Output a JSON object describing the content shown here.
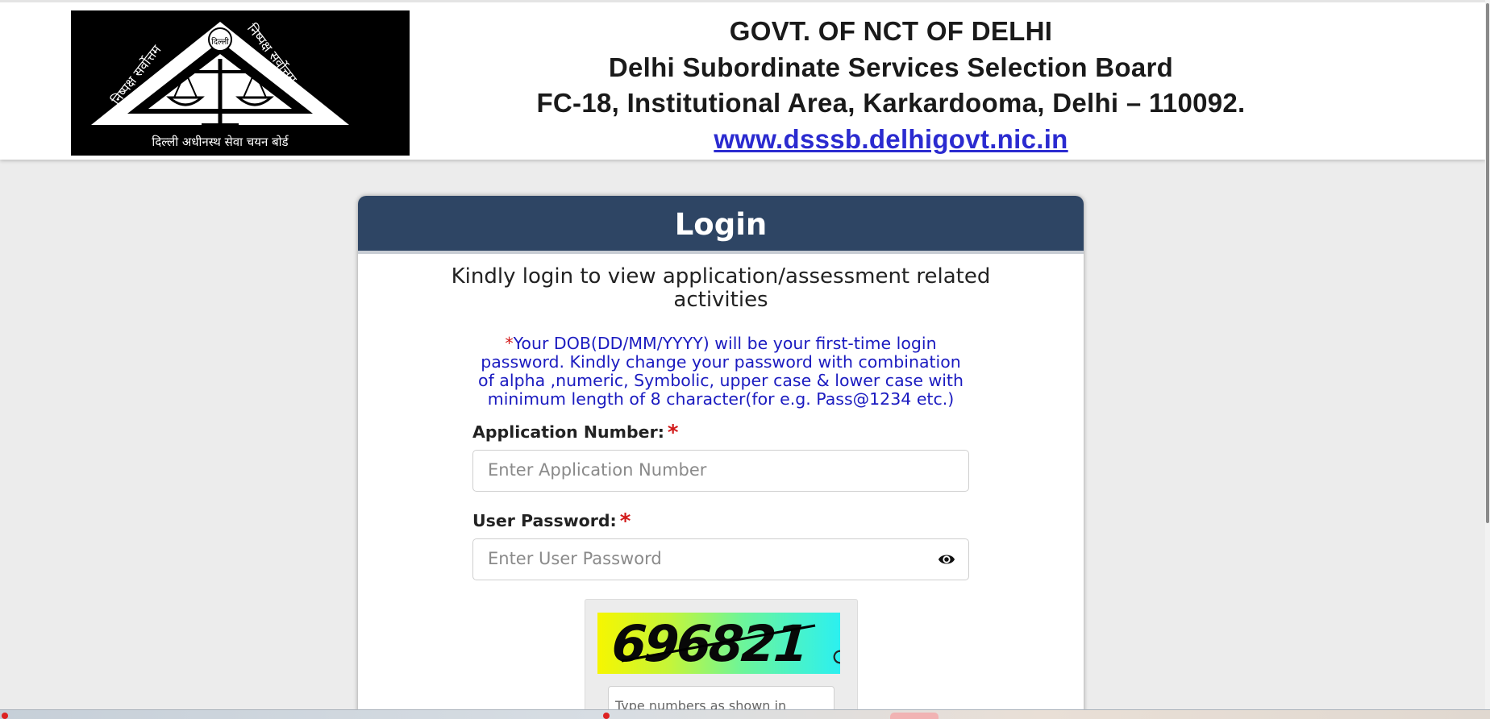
{
  "header": {
    "line1": "GOVT. OF NCT OF DELHI",
    "line2": "Delhi Subordinate Services Selection Board",
    "line3": "FC-18, Institutional Area, Karkardooma, Delhi – 110092.",
    "website": "www.dsssb.delhigovt.nic.in",
    "logo_motto": "दिल्ली अधीनस्थ सेवा चयन बोर्ड",
    "logo_top": "दिल्ली",
    "logo_left": "निष्पक्ष सर्वोत्तम",
    "logo_right": "निष्पक्ष सर्वोत्तम"
  },
  "login": {
    "title": "Login",
    "subtitle": "Kindly login to view application/assessment related activities",
    "note_star": "*",
    "note": "Your DOB(DD/MM/YYYY) will be your first-time login password. Kindly change your password with combination of alpha ,numeric, Symbolic, upper case & lower case with minimum length of 8 character(for e.g. Pass@1234 etc.)",
    "app_label": "Application Number:",
    "app_required": "*",
    "app_placeholder": "Enter Application Number",
    "pwd_label": "User Password:",
    "pwd_required": "*",
    "pwd_placeholder": "Enter User Password",
    "captcha_value": "696821",
    "captcha_placeholder": "Type numbers as shown in image"
  },
  "colors": {
    "card_header": "#2e4564",
    "note_text": "#1b1bc0",
    "required": "#d21a1a",
    "link": "#2b2bd0"
  },
  "icons": [
    "eye-icon",
    "refresh-icon"
  ]
}
